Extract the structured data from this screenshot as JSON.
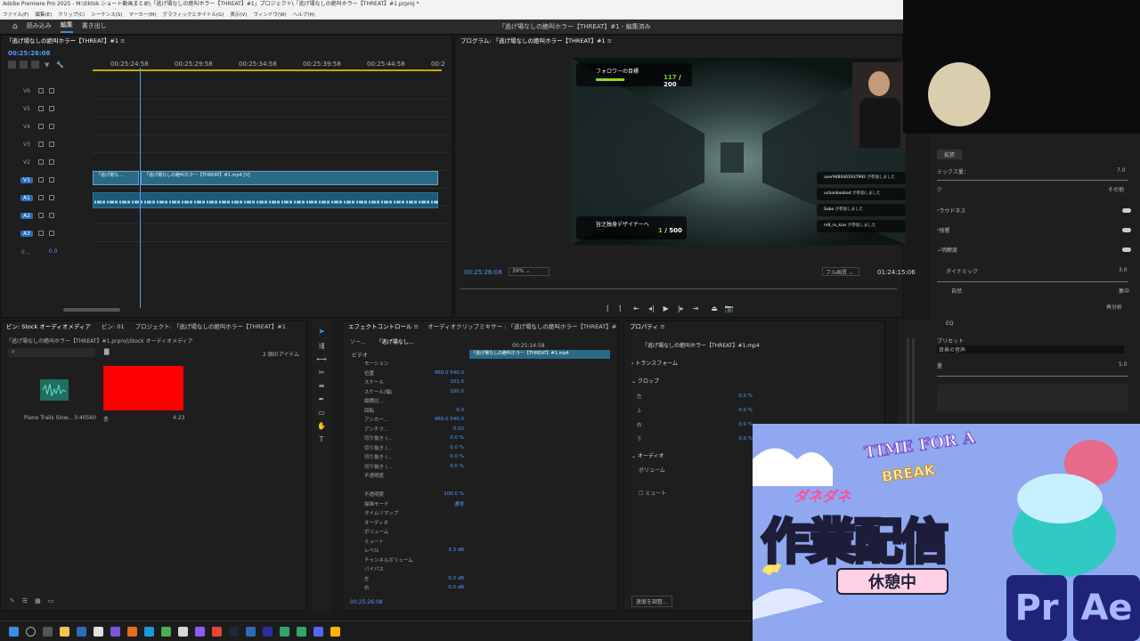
{
  "window": {
    "title": "Adobe Premiere Pro 2025 - M:\\tiktok ショート動画まとめ\\「逃げ場なしの絶叫ホラー【THREAT】#1」プロジェクト\\「逃げ場なしの絶叫ホラー【THREAT】#1.prproj *"
  },
  "menu": [
    "ファイル(F)",
    "編集(E)",
    "クリップ(C)",
    "シーケンス(S)",
    "マーカー(M)",
    "グラフィックとタイトル(G)",
    "表示(V)",
    "ウィンドウ(W)",
    "ヘルプ(H)"
  ],
  "workspace": {
    "tabs": [
      "読み込み",
      "編集",
      "書き出し"
    ],
    "active": 1,
    "doc_title": "「逃げ場なしの絶叫ホラー【THREAT】#1 - 編集済み"
  },
  "timeline": {
    "tab": "「逃げ場なしの絶叫ホラー【THREAT】#1",
    "timecode": "00:25:26:08",
    "ruler": [
      "00:25:24:58",
      "00:25:29:58",
      "00:25:34:58",
      "00:25:39:58",
      "00:25:44:58",
      "00:2"
    ],
    "video_tracks": [
      "V6",
      "V5",
      "V4",
      "V3",
      "V2",
      "V1"
    ],
    "audio_tracks": [
      "A1",
      "A2",
      "A3"
    ],
    "mix_label": "ミ...",
    "mix_value": "0.0",
    "clip_short": "「逃げ場な...",
    "clip_main": "「逃げ場なしの絶叫ホラー【THREAT】#1.mp4 [V]",
    "fx": "fx"
  },
  "program": {
    "tab": "プログラム: 「逃げ場なしの絶叫ホラー【THREAT】#1",
    "timecode": "00:25:26:08",
    "zoom": "39%",
    "quality": "フル画質",
    "duration": "01:24:15:06",
    "overlay": {
      "goal1_label": "フォロワーの目標",
      "goal1_value": "117",
      "goal1_total": "/ 200",
      "goal2_label": "旨之独身デザイナーへ",
      "goal2_value": "1",
      "goal2_total": "/ 500",
      "chat": [
        {
          "user": "user9480461937992",
          "msg": "が参加しました"
        },
        {
          "user": "uchanbaobad",
          "msg": "が参加しました"
        },
        {
          "user": "Sabo",
          "msg": "が参加しました"
        },
        {
          "user": "m8_ru_kias",
          "msg": "が参加しました"
        }
      ]
    }
  },
  "bin": {
    "tabs": [
      "ビン: Stock オーディオメディア",
      "ビン: 01",
      "プロジェクト: 「逃げ場なしの絶叫ホラー【THREAT】#1"
    ],
    "path": "「逃げ場なしの絶叫ホラー【THREAT】#1.prproj\\Stock オーディオメディア",
    "count": "2 個のアイテム",
    "items": [
      {
        "name": "Piano Trails Slow...",
        "dur": "3:40560",
        "color": "#1f6e5f"
      },
      {
        "name": "赤",
        "dur": "4:23",
        "color": "#ff0000"
      }
    ]
  },
  "effects": {
    "tabs": [
      "エフェクトコントロール",
      "オーディオクリップミキサー : 「逃げ場なしの絶叫ホラー【THREAT】#1"
    ],
    "source_tab": "ソー...",
    "seq_tab": "「逃げ場なし...",
    "tc": "00:25:14:58",
    "clip_label": "「逃げ場なしの絶叫ホラー【THREAT】#1.mp4",
    "section_video": "ビデオ",
    "rows": [
      {
        "label": "モーション",
        "val": ""
      },
      {
        "label": "位置",
        "val": "960.0   540.0"
      },
      {
        "label": "スケール",
        "val": "101.0"
      },
      {
        "label": "スケール(幅)",
        "val": "100.0"
      },
      {
        "label": "縦横比...",
        "val": ""
      },
      {
        "label": "回転",
        "val": "0.0"
      },
      {
        "label": "アンカー...",
        "val": "960.0   540.0"
      },
      {
        "label": "アンチフ...",
        "val": "0.00"
      },
      {
        "label": "切り抜き (...",
        "val": "0.0 %"
      },
      {
        "label": "切り抜き (...",
        "val": "0.0 %"
      },
      {
        "label": "切り抜き (...",
        "val": "0.0 %"
      },
      {
        "label": "切り抜き (...",
        "val": "0.0 %"
      },
      {
        "label": "不透明度",
        "val": ""
      },
      {
        "label": "",
        "val": ""
      },
      {
        "label": "不透明度",
        "val": "100.0 %"
      },
      {
        "label": "描画モード",
        "val": "通常"
      },
      {
        "label": "タイムリマップ",
        "val": ""
      },
      {
        "label": "オーディオ",
        "val": ""
      },
      {
        "label": "ボリューム",
        "val": ""
      },
      {
        "label": "ミュート",
        "val": ""
      },
      {
        "label": "レベル",
        "val": "3.3 dB"
      },
      {
        "label": "チャンネルボリューム",
        "val": ""
      },
      {
        "label": "バイパス",
        "val": ""
      },
      {
        "label": "左",
        "val": "0.0 dB"
      },
      {
        "label": "右",
        "val": "0.0 dB"
      }
    ],
    "footer_tc": "00:25:26:08"
  },
  "props": {
    "tab": "プロパティ",
    "clip": "「逃げ場なしの絶叫ホラー【THREAT】#1.mp4",
    "transform": "トランスフォーム",
    "crop": "クロップ",
    "crop_rows": [
      {
        "label": "左",
        "val": "0.0 %"
      },
      {
        "label": "上",
        "val": "0.0 %"
      },
      {
        "label": "右",
        "val": "0.0 %"
      },
      {
        "label": "下",
        "val": "0.0 %"
      }
    ],
    "audio": "オーディオ",
    "volume": "ボリューム",
    "mute": "ミュート",
    "speed": "速度を調整..."
  },
  "audio_panel": {
    "expand": "拡張",
    "mix_label": "ミックス量：",
    "mix_val": "7.0",
    "mix_min": "少",
    "mix_max": "その他",
    "sections": [
      "ラウドネス",
      "残響",
      "明瞭度"
    ],
    "dynamic": "ダイナミック",
    "dyn_val": "3.0",
    "dyn_min": "自然",
    "dyn_max": "集中",
    "analyze": "再分析",
    "eq": "EQ",
    "preset_label": "プリセット",
    "preset": "背景の音声",
    "amount_label": "量",
    "amount_val": "5.0"
  },
  "overlay_break": {
    "banner_top": "TIME FOR A",
    "banner_sub": "BREAK",
    "name": "ダネダネ",
    "title": "作業配信",
    "subtitle": "休憩中",
    "apps": [
      "Pr",
      "Ae"
    ]
  }
}
